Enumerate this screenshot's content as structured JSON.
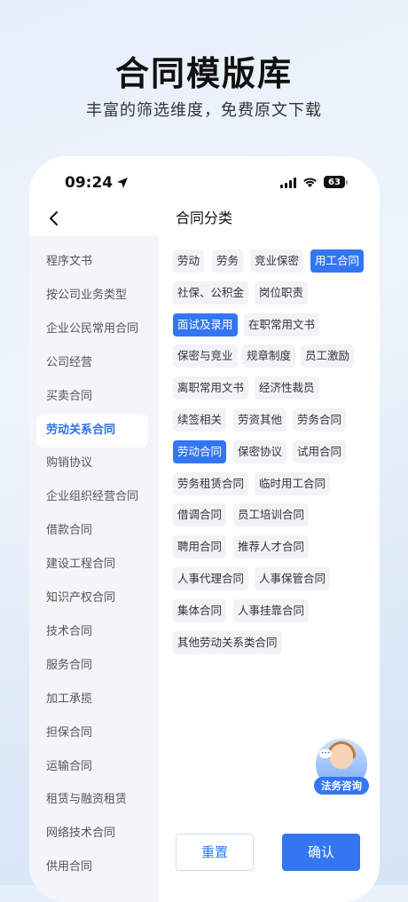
{
  "hero": {
    "title": "合同模版库",
    "subtitle": "丰富的筛选维度，免费原文下载"
  },
  "status_bar": {
    "time": "09:24",
    "battery": "63"
  },
  "nav": {
    "title": "合同分类"
  },
  "sidebar": {
    "active_index": 5,
    "items": [
      {
        "label": "程序文书"
      },
      {
        "label": "按公司业务类型"
      },
      {
        "label": "企业公民常用合同"
      },
      {
        "label": "公司经营"
      },
      {
        "label": "买卖合同"
      },
      {
        "label": "劳动关系合同"
      },
      {
        "label": "购销协议"
      },
      {
        "label": "企业组织经营合同"
      },
      {
        "label": "借款合同"
      },
      {
        "label": "建设工程合同"
      },
      {
        "label": "知识产权合同"
      },
      {
        "label": "技术合同"
      },
      {
        "label": "服务合同"
      },
      {
        "label": "加工承揽"
      },
      {
        "label": "担保合同"
      },
      {
        "label": "运输合同"
      },
      {
        "label": "租赁与融资租赁"
      },
      {
        "label": "网络技术合同"
      },
      {
        "label": "供用合同"
      }
    ]
  },
  "tags": [
    {
      "label": "劳动",
      "selected": false
    },
    {
      "label": "劳务",
      "selected": false
    },
    {
      "label": "竞业保密",
      "selected": false
    },
    {
      "label": "用工合同",
      "selected": true
    },
    {
      "label": "社保、公积金",
      "selected": false
    },
    {
      "label": "岗位职责",
      "selected": false
    },
    {
      "label": "面试及录用",
      "selected": true
    },
    {
      "label": "在职常用文书",
      "selected": false
    },
    {
      "label": "保密与竞业",
      "selected": false
    },
    {
      "label": "规章制度",
      "selected": false
    },
    {
      "label": "员工激励",
      "selected": false
    },
    {
      "label": "离职常用文书",
      "selected": false
    },
    {
      "label": "经济性裁员",
      "selected": false
    },
    {
      "label": "续签相关",
      "selected": false
    },
    {
      "label": "劳资其他",
      "selected": false
    },
    {
      "label": "劳务合同",
      "selected": false
    },
    {
      "label": "劳动合同",
      "selected": true
    },
    {
      "label": "保密协议",
      "selected": false
    },
    {
      "label": "试用合同",
      "selected": false
    },
    {
      "label": "劳务租赁合同",
      "selected": false
    },
    {
      "label": "临时用工合同",
      "selected": false
    },
    {
      "label": "借调合同",
      "selected": false
    },
    {
      "label": "员工培训合同",
      "selected": false
    },
    {
      "label": "聘用合同",
      "selected": false
    },
    {
      "label": "推荐人才合同",
      "selected": false
    },
    {
      "label": "人事代理合同",
      "selected": false
    },
    {
      "label": "人事保管合同",
      "selected": false
    },
    {
      "label": "集体合同",
      "selected": false
    },
    {
      "label": "人事挂靠合同",
      "selected": false
    },
    {
      "label": "其他劳动关系类合同",
      "selected": false
    }
  ],
  "consult": {
    "label": "法务咨询"
  },
  "actions": {
    "reset": "重置",
    "confirm": "确认"
  },
  "colors": {
    "accent": "#3376f2",
    "active_text": "#2f6ff0"
  }
}
